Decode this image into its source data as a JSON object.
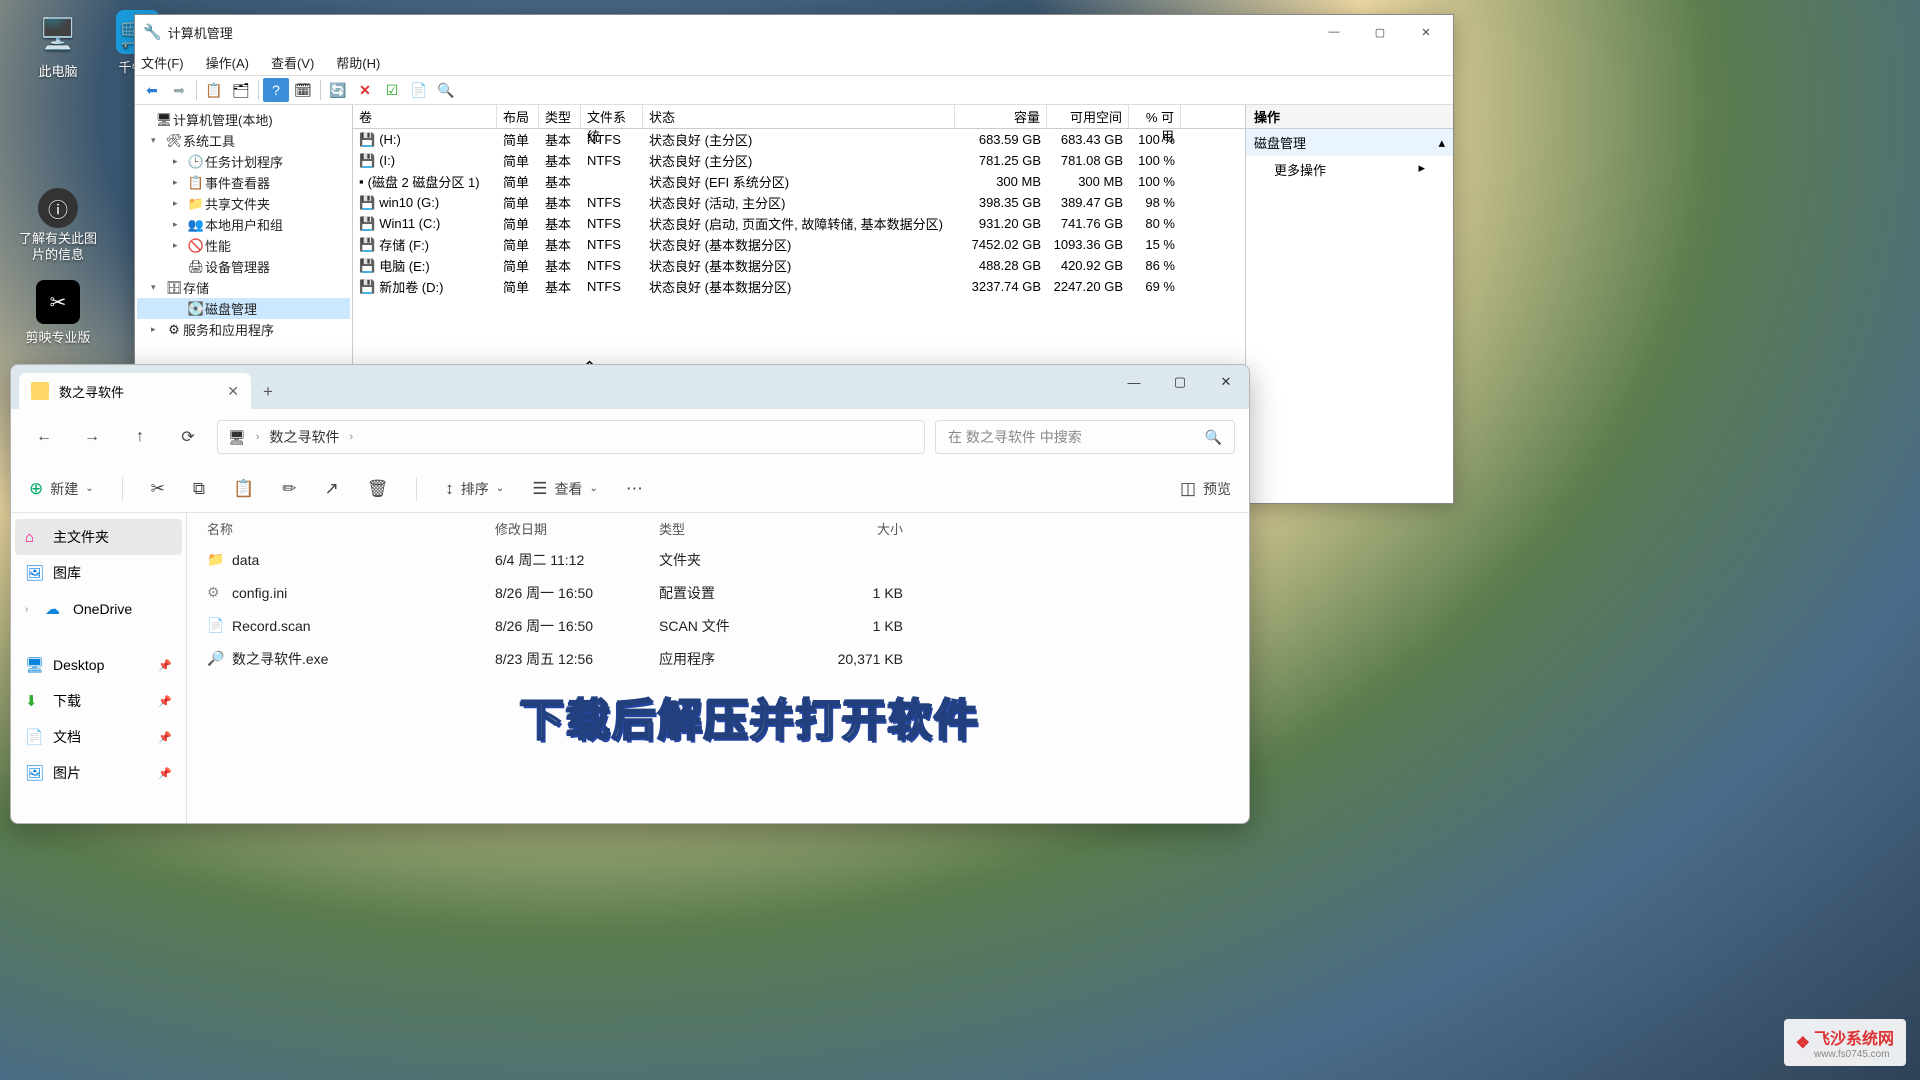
{
  "desktop": {
    "this_pc": "此电脑",
    "qianniu": "千牛工",
    "image_info": "了解有关此图\n片的信息",
    "jianying": "剪映专业版"
  },
  "compmgmt": {
    "title": "计算机管理",
    "menus": {
      "file": "文件(F)",
      "action": "操作(A)",
      "view": "查看(V)",
      "help": "帮助(H)"
    },
    "tree": {
      "root": "计算机管理(本地)",
      "system_tools": "系统工具",
      "task_scheduler": "任务计划程序",
      "event_viewer": "事件查看器",
      "shared_folders": "共享文件夹",
      "local_users": "本地用户和组",
      "performance": "性能",
      "device_manager": "设备管理器",
      "storage": "存储",
      "disk_management": "磁盘管理",
      "services": "服务和应用程序"
    },
    "cols": {
      "vol": "卷",
      "layout": "布局",
      "type": "类型",
      "fs": "文件系统",
      "status": "状态",
      "cap": "容量",
      "free": "可用空间",
      "pct": "% 可用"
    },
    "volumes": [
      {
        "name": "(H:)",
        "layout": "简单",
        "type": "基本",
        "fs": "NTFS",
        "status": "状态良好 (主分区)",
        "cap": "683.59 GB",
        "free": "683.43 GB",
        "pct": "100 %",
        "icon": "💾"
      },
      {
        "name": "(I:)",
        "layout": "简单",
        "type": "基本",
        "fs": "NTFS",
        "status": "状态良好 (主分区)",
        "cap": "781.25 GB",
        "free": "781.08 GB",
        "pct": "100 %",
        "icon": "💾"
      },
      {
        "name": "(磁盘 2 磁盘分区 1)",
        "layout": "简单",
        "type": "基本",
        "fs": "",
        "status": "状态良好 (EFI 系统分区)",
        "cap": "300 MB",
        "free": "300 MB",
        "pct": "100 %",
        "icon": "▪"
      },
      {
        "name": "win10 (G:)",
        "layout": "简单",
        "type": "基本",
        "fs": "NTFS",
        "status": "状态良好 (活动, 主分区)",
        "cap": "398.35 GB",
        "free": "389.47 GB",
        "pct": "98 %",
        "icon": "💾"
      },
      {
        "name": "Win11 (C:)",
        "layout": "简单",
        "type": "基本",
        "fs": "NTFS",
        "status": "状态良好 (启动, 页面文件, 故障转储, 基本数据分区)",
        "cap": "931.20 GB",
        "free": "741.76 GB",
        "pct": "80 %",
        "icon": "💾"
      },
      {
        "name": "存储 (F:)",
        "layout": "简单",
        "type": "基本",
        "fs": "NTFS",
        "status": "状态良好 (基本数据分区)",
        "cap": "7452.02 GB",
        "free": "1093.36 GB",
        "pct": "15 %",
        "icon": "💾"
      },
      {
        "name": "电脑 (E:)",
        "layout": "简单",
        "type": "基本",
        "fs": "NTFS",
        "status": "状态良好 (基本数据分区)",
        "cap": "488.28 GB",
        "free": "420.92 GB",
        "pct": "86 %",
        "icon": "💾"
      },
      {
        "name": "新加卷 (D:)",
        "layout": "简单",
        "type": "基本",
        "fs": "NTFS",
        "status": "状态良好 (基本数据分区)",
        "cap": "3237.74 GB",
        "free": "2247.20 GB",
        "pct": "69 %",
        "icon": "💾"
      }
    ],
    "actions": {
      "header": "操作",
      "section": "磁盘管理",
      "more": "更多操作"
    }
  },
  "explorer": {
    "tab_title": "数之寻软件",
    "breadcrumb": [
      "数之寻软件"
    ],
    "search_placeholder": "在 数之寻软件 中搜索",
    "toolbar": {
      "new": "新建",
      "sort": "排序",
      "view": "查看",
      "preview": "预览"
    },
    "nav": {
      "home": "主文件夹",
      "gallery": "图库",
      "onedrive": "OneDrive",
      "desktop": "Desktop",
      "downloads": "下载",
      "documents": "文档",
      "pictures": "图片"
    },
    "cols": {
      "name": "名称",
      "date": "修改日期",
      "type": "类型",
      "size": "大小"
    },
    "files": [
      {
        "name": "data",
        "date": "6/4 周二 11:12",
        "type": "文件夹",
        "size": "",
        "icon": "folder"
      },
      {
        "name": "config.ini",
        "date": "8/26 周一 16:50",
        "type": "配置设置",
        "size": "1 KB",
        "icon": "ini"
      },
      {
        "name": "Record.scan",
        "date": "8/26 周一 16:50",
        "type": "SCAN 文件",
        "size": "1 KB",
        "icon": "file"
      },
      {
        "name": "数之寻软件.exe",
        "date": "8/23 周五 12:56",
        "type": "应用程序",
        "size": "20,371 KB",
        "icon": "exe"
      }
    ]
  },
  "caption": "下载后解压并打开软件",
  "watermark": {
    "brand": "飞沙系统网",
    "url": "www.fs0745.com"
  }
}
